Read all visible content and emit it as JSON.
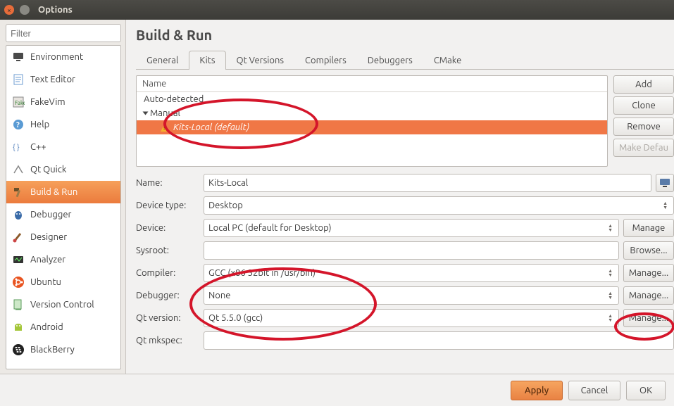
{
  "window": {
    "title": "Options"
  },
  "filter": {
    "placeholder": "Filter"
  },
  "sidebar": {
    "items": [
      {
        "label": "Environment"
      },
      {
        "label": "Text Editor"
      },
      {
        "label": "FakeVim"
      },
      {
        "label": "Help"
      },
      {
        "label": "C++"
      },
      {
        "label": "Qt Quick"
      },
      {
        "label": "Build & Run"
      },
      {
        "label": "Debugger"
      },
      {
        "label": "Designer"
      },
      {
        "label": "Analyzer"
      },
      {
        "label": "Ubuntu"
      },
      {
        "label": "Version Control"
      },
      {
        "label": "Android"
      },
      {
        "label": "BlackBerry"
      }
    ]
  },
  "heading": "Build & Run",
  "tabs": [
    "General",
    "Kits",
    "Qt Versions",
    "Compilers",
    "Debuggers",
    "CMake"
  ],
  "tree": {
    "header": "Name",
    "auto": "Auto-detected",
    "manual": "Manual",
    "kit": "Kits-Local (default)"
  },
  "buttons": {
    "add": "Add",
    "clone": "Clone",
    "remove": "Remove",
    "makedef": "Make Defau"
  },
  "form": {
    "name_l": "Name:",
    "name_v": "Kits-Local",
    "devtype_l": "Device type:",
    "devtype_v": "Desktop",
    "device_l": "Device:",
    "device_v": "Local PC (default for Desktop)",
    "sysroot_l": "Sysroot:",
    "sysroot_v": "",
    "compiler_l": "Compiler:",
    "compiler_v": "GCC (x86 32bit in /usr/bin)",
    "debugger_l": "Debugger:",
    "debugger_v": "None",
    "qtver_l": "Qt version:",
    "qtver_v": "Qt 5.5.0 (gcc)",
    "mkspec_l": "Qt mkspec:",
    "mkspec_v": "",
    "manage": "Manage",
    "manage_e": "Manage...",
    "browse": "Browse..."
  },
  "footer": {
    "apply": "Apply",
    "cancel": "Cancel",
    "ok": "OK"
  }
}
